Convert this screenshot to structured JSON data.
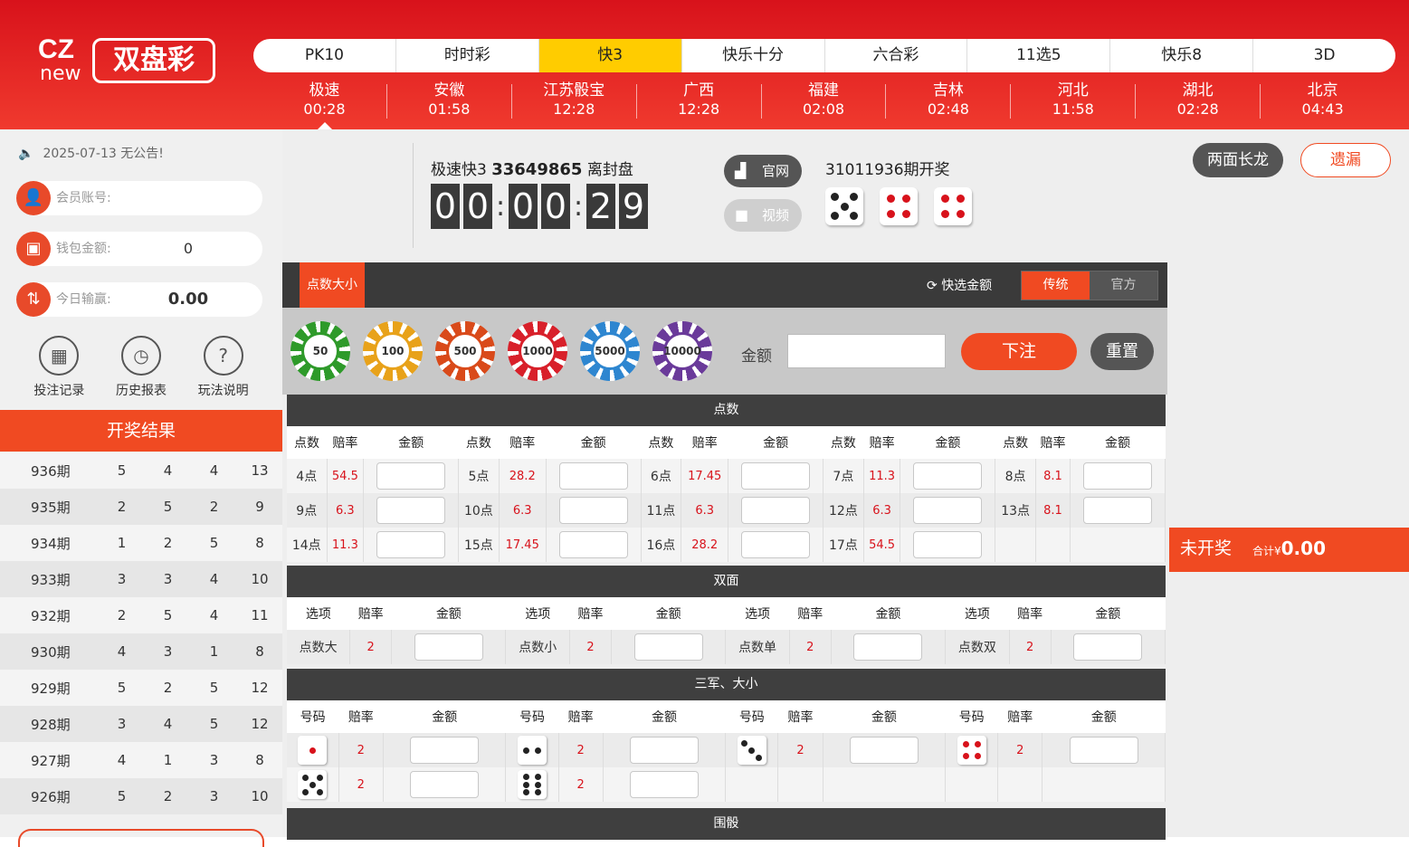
{
  "logo": {
    "cz": "CZ",
    "new": "new",
    "name": "双盘彩"
  },
  "top_tabs": [
    "PK10",
    "时时彩",
    "快3",
    "快乐十分",
    "六合彩",
    "11选5",
    "快乐8",
    "3D"
  ],
  "active_top_tab": "快3",
  "sub_games": [
    {
      "name": "极速",
      "time": "00:28"
    },
    {
      "name": "安徽",
      "time": "01:58"
    },
    {
      "name": "江苏骰宝",
      "time": "12:28"
    },
    {
      "name": "广西",
      "time": "12:28"
    },
    {
      "name": "福建",
      "time": "02:08"
    },
    {
      "name": "吉林",
      "time": "02:48"
    },
    {
      "name": "河北",
      "time": "11:58"
    },
    {
      "name": "湖北",
      "time": "02:28"
    },
    {
      "name": "北京",
      "time": "04:43"
    }
  ],
  "sidebar": {
    "notice": "2025-07-13 无公告!",
    "member_label": "会员账号:",
    "wallet_label": "钱包金额:",
    "wallet_value": "0",
    "today_label": "今日输赢:",
    "today_value": "0.00",
    "tools": [
      "投注记录",
      "历史报表",
      "玩法说明"
    ],
    "results_title": "开奖结果",
    "results": [
      {
        "p": "936期",
        "a": "5",
        "b": "4",
        "c": "4",
        "s": "13"
      },
      {
        "p": "935期",
        "a": "2",
        "b": "5",
        "c": "2",
        "s": "9"
      },
      {
        "p": "934期",
        "a": "1",
        "b": "2",
        "c": "5",
        "s": "8"
      },
      {
        "p": "933期",
        "a": "3",
        "b": "3",
        "c": "4",
        "s": "10"
      },
      {
        "p": "932期",
        "a": "2",
        "b": "5",
        "c": "4",
        "s": "11"
      },
      {
        "p": "930期",
        "a": "4",
        "b": "3",
        "c": "1",
        "s": "8"
      },
      {
        "p": "929期",
        "a": "5",
        "b": "2",
        "c": "5",
        "s": "12"
      },
      {
        "p": "928期",
        "a": "3",
        "b": "4",
        "c": "5",
        "s": "12"
      },
      {
        "p": "927期",
        "a": "4",
        "b": "1",
        "c": "3",
        "s": "8"
      },
      {
        "p": "926期",
        "a": "5",
        "b": "2",
        "c": "3",
        "s": "10"
      }
    ]
  },
  "game": {
    "name": "极速快3",
    "issue": "33649865",
    "status": "离封盘",
    "countdown": [
      "0",
      "0",
      "0",
      "0",
      "2",
      "9"
    ],
    "official_label": "官网",
    "video_label": "视频",
    "last_issue": "31011936期开奖",
    "last_dice": [
      5,
      4,
      4
    ]
  },
  "bet": {
    "tab": "点数大小",
    "quick_label": "快选金额",
    "mode_traditional": "传统",
    "mode_official": "官方",
    "chips": [
      "50",
      "100",
      "500",
      "1000",
      "5000",
      "10000"
    ],
    "amount_label": "金额",
    "bet_button": "下注",
    "reset_button": "重置"
  },
  "points": {
    "title": "点数",
    "h_item": "点数",
    "h_odds": "赔率",
    "h_amount": "金额",
    "rows": [
      [
        {
          "k": "4点",
          "o": "54.5"
        },
        {
          "k": "5点",
          "o": "28.2"
        },
        {
          "k": "6点",
          "o": "17.45"
        },
        {
          "k": "7点",
          "o": "11.3"
        },
        {
          "k": "8点",
          "o": "8.1"
        }
      ],
      [
        {
          "k": "9点",
          "o": "6.3"
        },
        {
          "k": "10点",
          "o": "6.3"
        },
        {
          "k": "11点",
          "o": "6.3"
        },
        {
          "k": "12点",
          "o": "6.3"
        },
        {
          "k": "13点",
          "o": "8.1"
        }
      ],
      [
        {
          "k": "14点",
          "o": "11.3"
        },
        {
          "k": "15点",
          "o": "17.45"
        },
        {
          "k": "16点",
          "o": "28.2"
        },
        {
          "k": "17点",
          "o": "54.5"
        }
      ]
    ]
  },
  "double": {
    "title": "双面",
    "h_item": "选项",
    "h_odds": "赔率",
    "h_amount": "金额",
    "items": [
      {
        "k": "点数大",
        "o": "2"
      },
      {
        "k": "点数小",
        "o": "2"
      },
      {
        "k": "点数单",
        "o": "2"
      },
      {
        "k": "点数双",
        "o": "2"
      }
    ]
  },
  "sanjun": {
    "title": "三军、大小",
    "h_item": "号码",
    "h_odds": "赔率",
    "h_amount": "金额",
    "rows": [
      [
        {
          "d": 1,
          "o": "2"
        },
        {
          "d": 2,
          "o": "2"
        },
        {
          "d": 3,
          "o": "2"
        },
        {
          "d": 4,
          "o": "2"
        }
      ],
      [
        {
          "d": 5,
          "o": "2"
        },
        {
          "d": 6,
          "o": "2"
        }
      ]
    ]
  },
  "weitou": {
    "title": "围骰"
  },
  "right": {
    "longdragon": "两面长龙",
    "missing": "遗漏",
    "status": "未开奖",
    "total_label": "合计¥",
    "total_value": "0.00"
  },
  "colors": {
    "brand_red": "#f04a22",
    "header_red": "#d8121b",
    "active_tab": "#ffcc00",
    "odds_red": "#d8121b"
  }
}
